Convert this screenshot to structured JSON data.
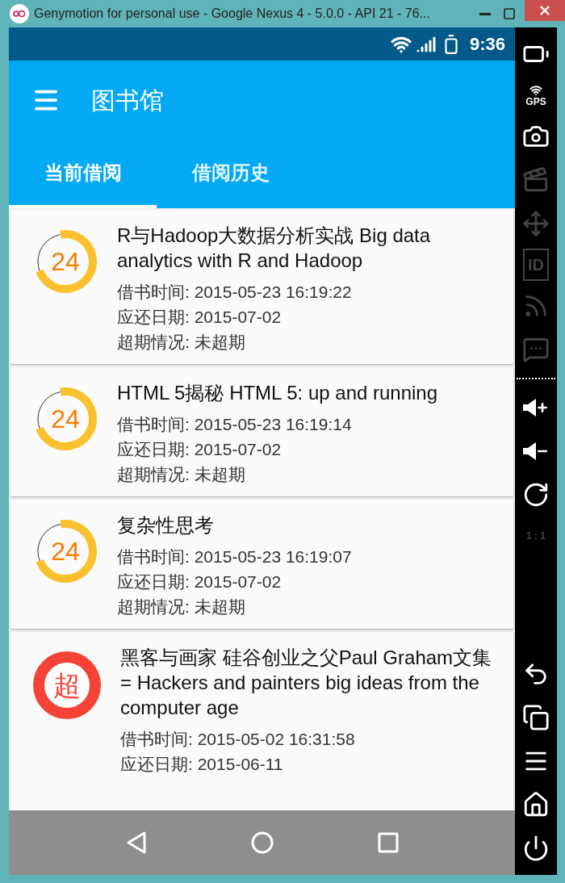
{
  "window": {
    "title": "Genymotion for personal use - Google Nexus 4 - 5.0.0 - API 21 - 76..."
  },
  "status_bar": {
    "time": "9:36"
  },
  "app_bar": {
    "title": "图书馆"
  },
  "tabs": [
    {
      "label": "当前借阅",
      "selected": true
    },
    {
      "label": "借阅历史",
      "selected": false
    }
  ],
  "loans": [
    {
      "title": "R与Hadoop大数据分析实战 Big data analytics with R and Hadoop",
      "kind": "countdown",
      "badge": "24",
      "lines": [
        "借书时间: 2015-05-23 16:19:22",
        "应还日期: 2015-07-02",
        "超期情况: 未超期"
      ]
    },
    {
      "title": "HTML 5揭秘 HTML 5: up and running",
      "kind": "countdown",
      "badge": "24",
      "lines": [
        "借书时间: 2015-05-23 16:19:14",
        "应还日期: 2015-07-02",
        "超期情况: 未超期"
      ]
    },
    {
      "title": "复杂性思考",
      "kind": "countdown",
      "badge": "24",
      "lines": [
        "借书时间: 2015-05-23 16:19:07",
        "应还日期: 2015-07-02",
        "超期情况: 未超期"
      ]
    },
    {
      "title": "黑客与画家 硅谷创业之父Paul Graham文集 = Hackers and painters big ideas from the computer age",
      "kind": "overdue",
      "badge": "超",
      "lines": [
        "借书时间: 2015-05-02 16:31:58",
        "应还日期: 2015-06-11"
      ]
    }
  ],
  "side_toolbar": [
    {
      "kind": "battery",
      "disabled": false
    },
    {
      "kind": "gps",
      "label": "GPS",
      "disabled": false
    },
    {
      "kind": "camera",
      "disabled": false
    },
    {
      "kind": "clapper",
      "disabled": true
    },
    {
      "kind": "dpad",
      "disabled": true
    },
    {
      "kind": "id",
      "label": "ID",
      "disabled": true
    },
    {
      "kind": "rss",
      "disabled": true
    },
    {
      "kind": "sms",
      "disabled": true
    },
    {
      "kind": "separator"
    },
    {
      "kind": "volume-up",
      "disabled": false
    },
    {
      "kind": "volume-down",
      "disabled": false
    },
    {
      "kind": "rotate",
      "disabled": false
    },
    {
      "kind": "scale",
      "label": "1 : 1",
      "disabled": true
    },
    {
      "kind": "spacer"
    },
    {
      "kind": "back",
      "disabled": false
    },
    {
      "kind": "recent",
      "disabled": false
    },
    {
      "kind": "menu",
      "disabled": false
    },
    {
      "kind": "home",
      "disabled": false
    },
    {
      "kind": "power",
      "disabled": false
    }
  ]
}
